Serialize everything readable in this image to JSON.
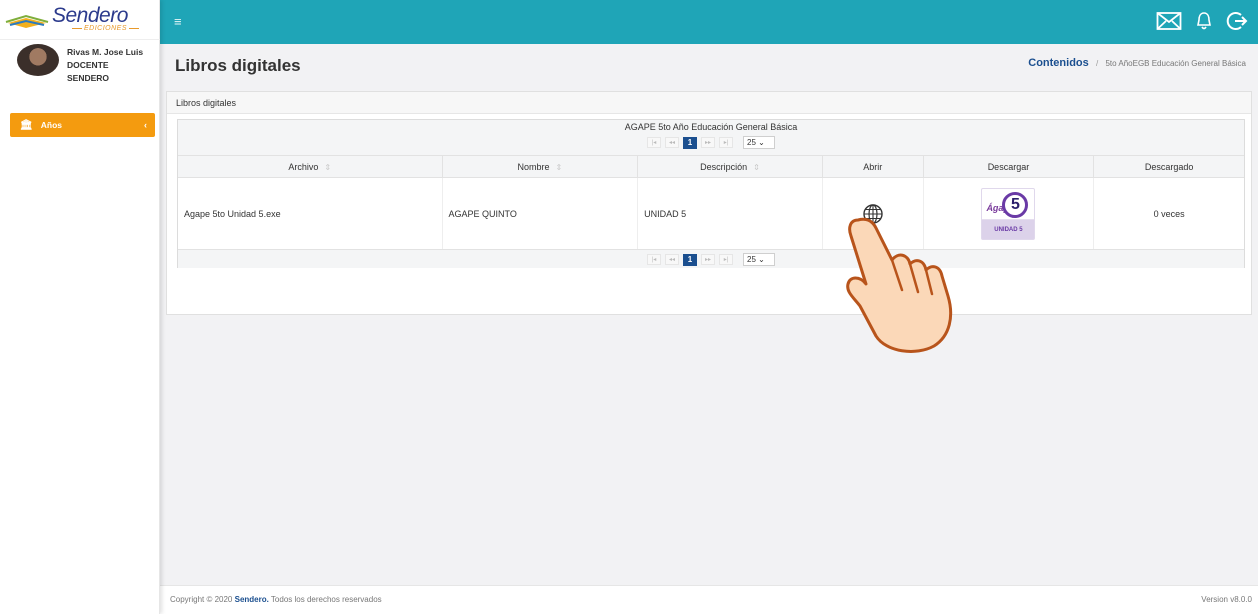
{
  "brand": {
    "name": "Sendero",
    "sub": "EDICIONES"
  },
  "user": {
    "name": "Rivas M. Jose Luis",
    "role": "DOCENTE",
    "org": "SENDERO"
  },
  "sidebar": {
    "items": [
      {
        "label": "Años",
        "icon": "bank-icon",
        "active": true,
        "color": "#f49b0f"
      }
    ]
  },
  "topbar": {
    "menu_icon": "≡",
    "color": "#1fa5b7",
    "icons": [
      "mail-icon",
      "bell-icon",
      "logout-icon"
    ]
  },
  "page": {
    "title": "Libros digitales"
  },
  "breadcrumb": {
    "root": "Contenidos",
    "current": "5to AñoEGB Educación General Básica"
  },
  "panel": {
    "heading": "Libros digitales"
  },
  "table": {
    "caption": "AGAPE 5to Año Educación General Básica",
    "pager": {
      "current_page": "1",
      "page_size": "25"
    },
    "columns": [
      "Archivo",
      "Nombre",
      "Descripción",
      "Abrir",
      "Descargar",
      "Descargado"
    ],
    "rows": [
      {
        "archivo": "Agape 5to Unidad 5.exe",
        "nombre": "AGAPE QUINTO",
        "descripcion": "UNIDAD 5",
        "abrir_icon": "globe-icon",
        "descargar_thumb_number": "5",
        "descargar_thumb_label": "UNIDAD 5",
        "descargado": "0 veces"
      }
    ]
  },
  "footer": {
    "copyright_prefix": "Copyright © 2020",
    "brand": "Sendero.",
    "rights": "Todos los derechos reservados",
    "version": "Version v8.0.0"
  }
}
